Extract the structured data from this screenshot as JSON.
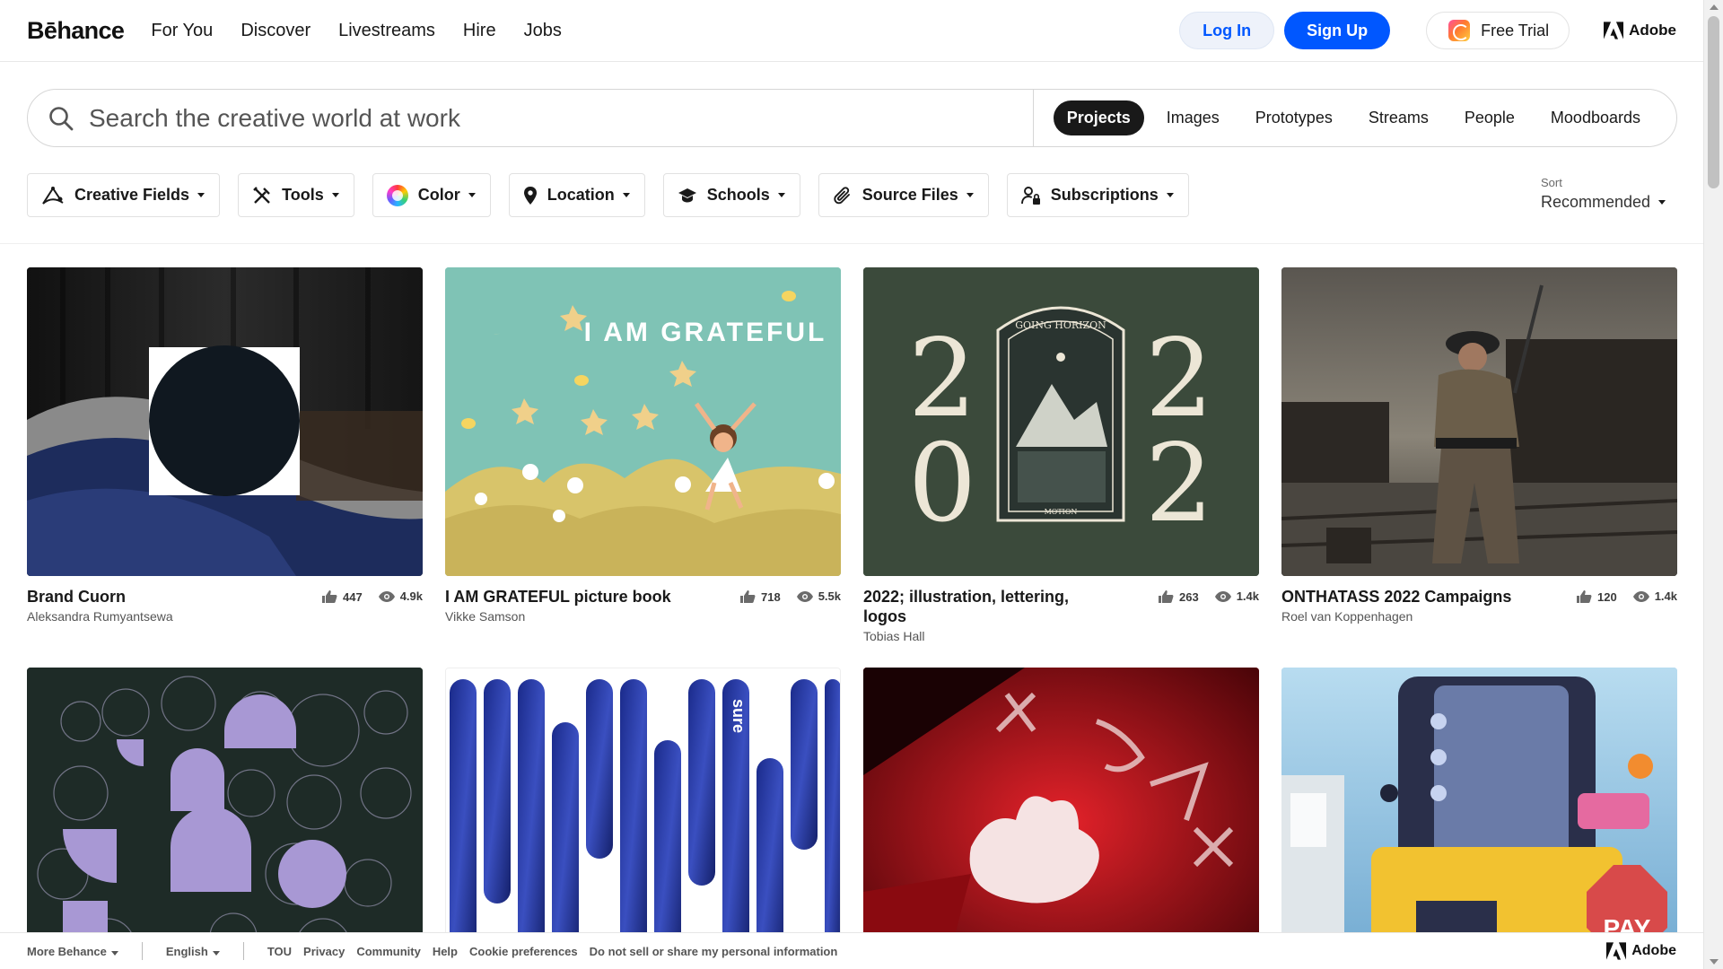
{
  "header": {
    "logo": "Bēhance",
    "nav": [
      "For You",
      "Discover",
      "Livestreams",
      "Hire",
      "Jobs"
    ],
    "login": "Log In",
    "signup": "Sign Up",
    "trial": "Free Trial",
    "adobe": "Adobe"
  },
  "search": {
    "placeholder": "Search the creative world at work",
    "tabs": [
      "Projects",
      "Images",
      "Prototypes",
      "Streams",
      "People",
      "Moodboards"
    ],
    "active_tab": "Projects"
  },
  "filters": {
    "creative_fields": "Creative Fields",
    "tools": "Tools",
    "color": "Color",
    "location": "Location",
    "schools": "Schools",
    "source_files": "Source Files",
    "subscriptions": "Subscriptions",
    "sort_label": "Sort",
    "sort_value": "Recommended"
  },
  "projects": [
    {
      "title": "Brand Cuorn",
      "author": "Aleksandra Rumyantsewa",
      "likes": "447",
      "views": "4.9k"
    },
    {
      "title": "I AM GRATEFUL picture book",
      "author": "Vikke Samson",
      "likes": "718",
      "views": "5.5k",
      "art_text": "I AM GRATEFUL"
    },
    {
      "title": "2022; illustration, lettering, logos",
      "author": "Tobias Hall",
      "likes": "263",
      "views": "1.4k",
      "digits": [
        "2",
        "2",
        "0",
        "2"
      ],
      "badge_top": "GOING HORIZON",
      "badge_bottom": "MOTION"
    },
    {
      "title": "ONTHATASS 2022 Campaigns",
      "author": "Roel van Koppenhagen",
      "likes": "120",
      "views": "1.4k"
    },
    {
      "title": "",
      "author": "",
      "likes": "",
      "views": ""
    },
    {
      "title": "",
      "author": "",
      "likes": "",
      "views": "",
      "art_text": "sure"
    },
    {
      "title": "",
      "author": "",
      "likes": "",
      "views": ""
    },
    {
      "title": "",
      "author": "",
      "likes": "",
      "views": "",
      "art_text": "PAY"
    }
  ],
  "footer": {
    "more": "More Behance",
    "language": "English",
    "links": [
      "TOU",
      "Privacy",
      "Community",
      "Help",
      "Cookie preferences",
      "Do not sell or share my personal information"
    ],
    "adobe": "Adobe"
  },
  "colors": {
    "accent": "#0057ff",
    "dark_tab": "#191919",
    "card2_bg": "#7cc0b3",
    "card3_bg": "#3b4a3b",
    "card7_bg": "#c4101a"
  }
}
